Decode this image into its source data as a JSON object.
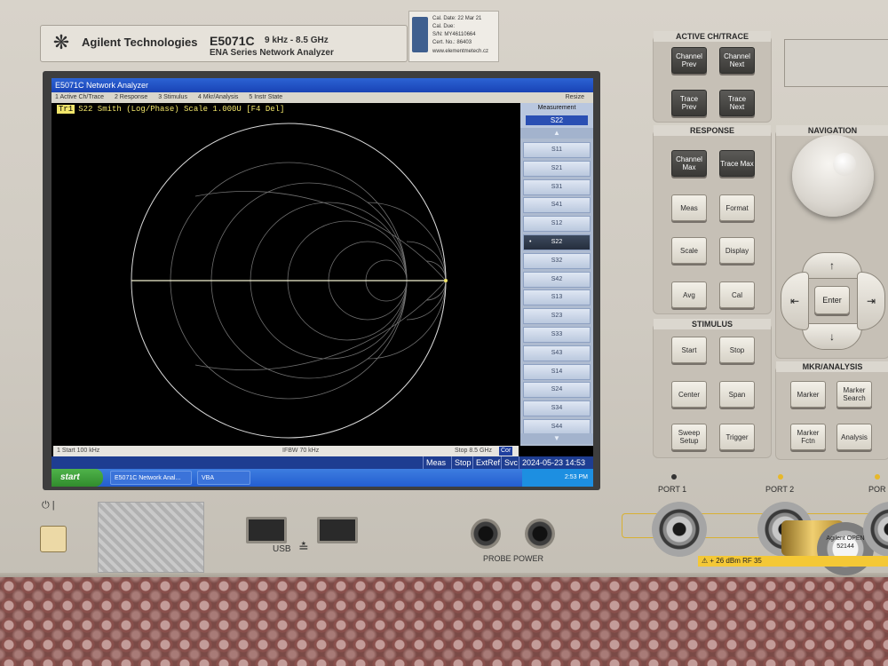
{
  "instrument": {
    "brand": "Agilent Technologies",
    "model": "E5071C",
    "frequency_range": "9 kHz - 8.5 GHz",
    "series": "ENA Series  Network Analyzer"
  },
  "calibration_label": {
    "cal_date_label": "Cal. Date:",
    "cal_date": "22 Mar 21",
    "cal_due_label": "Cal. Due:",
    "cal_due": "",
    "sn_label": "S/N:",
    "sn": "MY46110664",
    "cert_label": "Cert. No.:",
    "cert": "86403",
    "url": "www.elementmetech.cz"
  },
  "screen": {
    "window_title": "E5071C Network Analyzer",
    "menu": [
      "1 Active Ch/Trace",
      "2 Response",
      "3 Stimulus",
      "4 Mkr/Analysis",
      "5 Instr State"
    ],
    "resize_label": "Resize",
    "trace_badge": "Tr1",
    "trace_label": "S22 Smith (Log/Phase) Scale 1.000U [F4 Del]",
    "status_start": "1  Start 100 kHz",
    "status_ifbw": "IFBW 70 kHz",
    "status_stop": "Stop 8.5 GHz",
    "status_cor": "Cor",
    "measurement_panel": {
      "title": "Measurement",
      "current": "S22",
      "items": [
        "S11",
        "S21",
        "S31",
        "S41",
        "S12",
        "S22",
        "S32",
        "S42",
        "S13",
        "S23",
        "S33",
        "S43",
        "S14",
        "S24",
        "S34",
        "S44"
      ],
      "selected": "S22"
    },
    "bottom_bar": {
      "meas": "Meas",
      "stop": "Stop",
      "extref": "ExtRef",
      "svc": "Svc",
      "datetime": "2024-05-23 14:53"
    },
    "taskbar": {
      "start": "start",
      "item1": "E5071C Network Anal...",
      "item2": "VBA",
      "time": "2:53 PM"
    }
  },
  "hardkeys": {
    "active_ch_trace": {
      "title": "ACTIVE CH/TRACE",
      "keys": [
        "Channel Prev",
        "Channel Next",
        "Trace Prev",
        "Trace Next"
      ]
    },
    "response": {
      "title": "RESPONSE",
      "keys": [
        "Channel Max",
        "Trace Max",
        "Meas",
        "Format",
        "Scale",
        "Display",
        "Avg",
        "Cal"
      ]
    },
    "stimulus": {
      "title": "STIMULUS",
      "keys": [
        "Start",
        "Stop",
        "Center",
        "Span",
        "Sweep Setup",
        "Trigger"
      ]
    },
    "navigation": {
      "title": "NAVIGATION",
      "enter": "Enter",
      "up": "↑",
      "down": "↓",
      "left": "⇤",
      "right": "⇥"
    },
    "mkr_analysis": {
      "title": "MKR/ANALYSIS",
      "keys": [
        "Marker",
        "Marker Search",
        "Marker Fctn",
        "Analysis"
      ]
    }
  },
  "front_panel": {
    "usb_label": "USB",
    "probe_power_label": "PROBE POWER",
    "port1_label": "PORT 1",
    "port2_label": "PORT 2",
    "port3_label": "POR",
    "warning": "⚠ + 26 dBm  RF  35",
    "cal_kit_text": "Agilent OPEN 52144"
  },
  "colors": {
    "trace": "#f1e56a",
    "smith_grid": "#7a7a7a",
    "selection": "#2a4fb3"
  }
}
